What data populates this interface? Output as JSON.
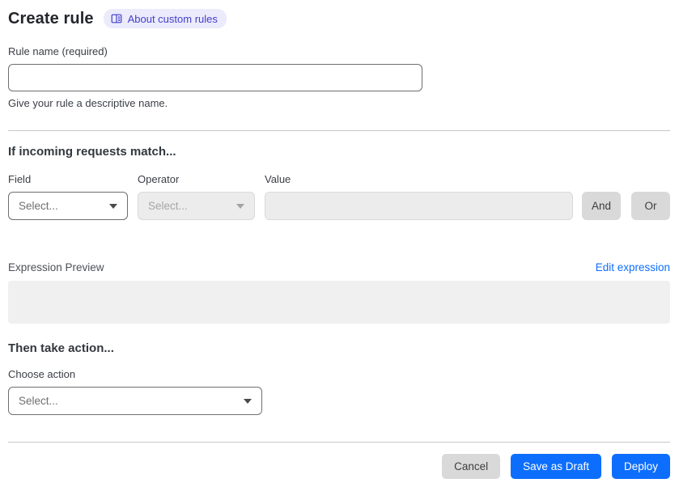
{
  "header": {
    "title": "Create rule",
    "badge": {
      "label": "About custom rules",
      "icon": "book-icon"
    }
  },
  "rule_name": {
    "label": "Rule name (required)",
    "value": "",
    "help": "Give your rule a descriptive name."
  },
  "match_section": {
    "heading": "If incoming requests match...",
    "field": {
      "label": "Field",
      "value": "Select...",
      "disabled": false
    },
    "operator": {
      "label": "Operator",
      "value": "Select...",
      "disabled": true
    },
    "value": {
      "label": "Value",
      "value": "",
      "disabled": true
    },
    "and_button": "And",
    "or_button": "Or",
    "expression_preview_label": "Expression Preview",
    "edit_expression_link": "Edit expression",
    "expression_value": ""
  },
  "action_section": {
    "heading": "Then take action...",
    "choose_label": "Choose action",
    "select_value": "Select..."
  },
  "footer": {
    "cancel": "Cancel",
    "save_draft": "Save as Draft",
    "deploy": "Deploy"
  },
  "colors": {
    "accent_blue": "#0d6efd",
    "badge_bg": "#ecebfc",
    "badge_text": "#4340c8",
    "disabled_bg": "#ececec",
    "gray_button_bg": "#d9d9d9",
    "divider": "#c8c8c8",
    "preview_box_bg": "#f0f0f0"
  }
}
